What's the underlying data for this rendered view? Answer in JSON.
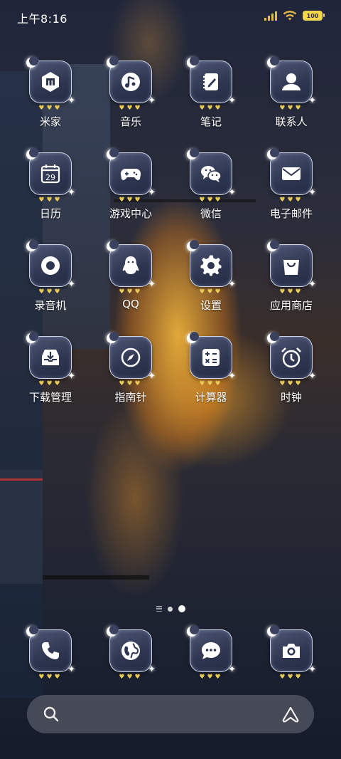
{
  "status_bar": {
    "time": "上午8:16",
    "battery": "100"
  },
  "apps": [
    {
      "label": "米家",
      "icon": "mi-home-icon"
    },
    {
      "label": "音乐",
      "icon": "music-icon"
    },
    {
      "label": "笔记",
      "icon": "notes-icon"
    },
    {
      "label": "联系人",
      "icon": "contacts-icon"
    },
    {
      "label": "日历",
      "icon": "calendar-icon",
      "calendar_day": "29"
    },
    {
      "label": "游戏中心",
      "icon": "gamepad-icon"
    },
    {
      "label": "微信",
      "icon": "wechat-icon"
    },
    {
      "label": "电子邮件",
      "icon": "mail-icon"
    },
    {
      "label": "录音机",
      "icon": "recorder-icon"
    },
    {
      "label": "QQ",
      "icon": "qq-penguin-icon"
    },
    {
      "label": "设置",
      "icon": "gear-icon"
    },
    {
      "label": "应用商店",
      "icon": "shopping-bag-icon"
    },
    {
      "label": "下载管理",
      "icon": "download-tray-icon"
    },
    {
      "label": "指南针",
      "icon": "compass-icon"
    },
    {
      "label": "计算器",
      "icon": "calculator-icon"
    },
    {
      "label": "时钟",
      "icon": "alarm-clock-icon"
    }
  ],
  "dock": [
    {
      "icon": "phone-icon"
    },
    {
      "icon": "browser-globe-icon"
    },
    {
      "icon": "messages-icon"
    },
    {
      "icon": "camera-icon"
    }
  ],
  "page_indicator": {
    "pages": 2,
    "current": 2
  },
  "colors": {
    "tile_bg": "#2e3550",
    "heart": "#f3d35a",
    "battery": "#f5d74a",
    "signal": "#e8b84a"
  }
}
